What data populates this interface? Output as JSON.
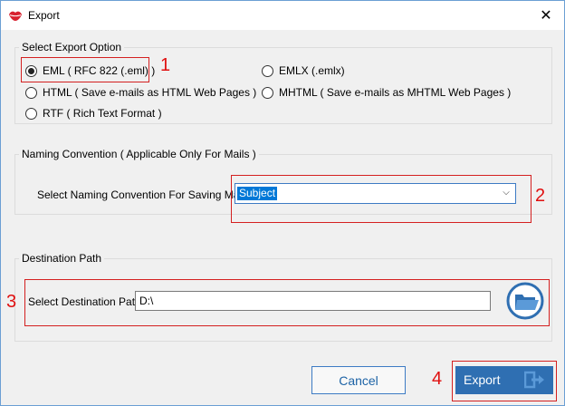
{
  "window": {
    "title": "Export",
    "app_icon": "lips-icon",
    "close_glyph": "✕"
  },
  "export_option": {
    "legend": "Select Export Option",
    "options": [
      {
        "label": "EML ( RFC 822 (.eml) )",
        "checked": true
      },
      {
        "label": "EMLX (.emlx)",
        "checked": false
      },
      {
        "label": "HTML ( Save e-mails as HTML Web Pages )",
        "checked": false
      },
      {
        "label": "MHTML ( Save e-mails as MHTML Web Pages )",
        "checked": false
      },
      {
        "label": "RTF ( Rich Text Format )",
        "checked": false
      }
    ]
  },
  "naming": {
    "legend": "Naming Convention ( Applicable Only For Mails )",
    "label": "Select Naming Convention For Saving Mails",
    "selected": "Subject"
  },
  "destination": {
    "legend": "Destination Path",
    "label": "Select Destination Path",
    "value": "D:\\",
    "browse_icon": "folder-open-icon"
  },
  "buttons": {
    "cancel": "Cancel",
    "export": "Export"
  },
  "annotations": [
    "1",
    "2",
    "3",
    "4"
  ],
  "colors": {
    "annotation": "#e01010",
    "accent": "#2f6fb2"
  }
}
